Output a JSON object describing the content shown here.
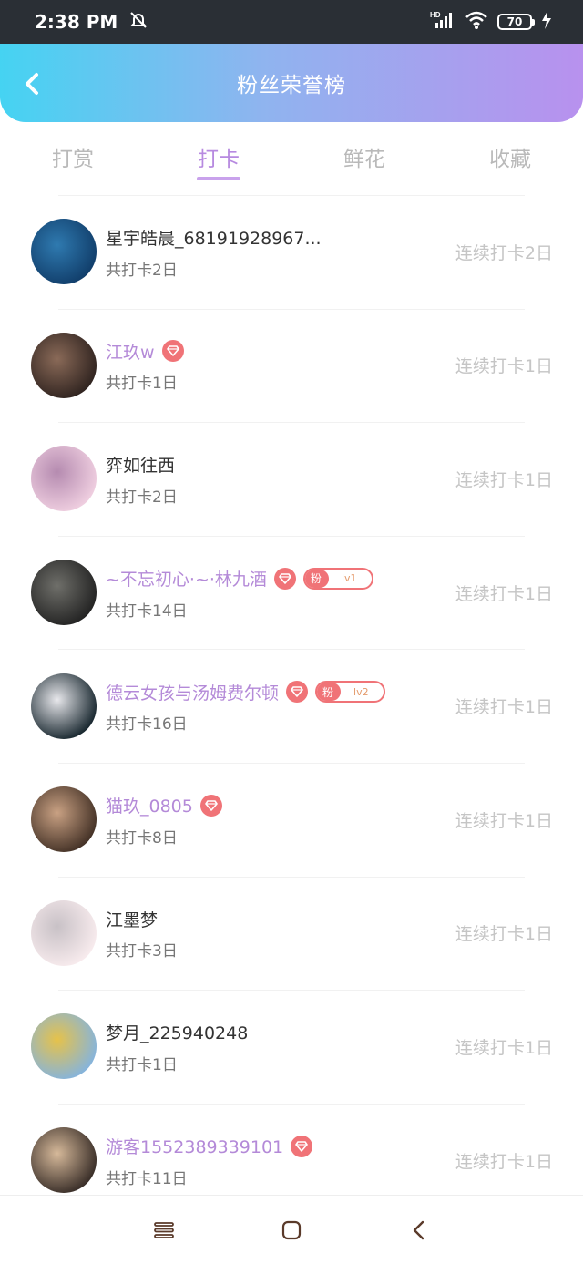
{
  "status_bar": {
    "time": "2:38 PM",
    "battery": "70",
    "network": "HD",
    "icons": [
      "mute-bell-icon",
      "signal-icon",
      "wifi-icon",
      "battery-icon",
      "charging-icon"
    ]
  },
  "header": {
    "title": "粉丝荣誉榜",
    "back_icon": "chevron-left-icon"
  },
  "tabs": [
    {
      "label": "打赏",
      "active": false
    },
    {
      "label": "打卡",
      "active": true
    },
    {
      "label": "鲜花",
      "active": false
    },
    {
      "label": "收藏",
      "active": false
    }
  ],
  "rows": [
    {
      "name": "星宇皓晨_68191928967...",
      "vip": false,
      "total": "共打卡2日",
      "streak": "连续打卡2日",
      "avatar": [
        "#0f3a66",
        "#2f7ab0"
      ]
    },
    {
      "name": "江玖w",
      "vip": true,
      "total": "共打卡1日",
      "streak": "连续打卡1日",
      "avatar": [
        "#2a1f1c",
        "#8a6a58"
      ]
    },
    {
      "name": "弈如往西",
      "vip": false,
      "total": "共打卡2日",
      "streak": "连续打卡1日",
      "avatar": [
        "#f3d3e3",
        "#b58bb0"
      ]
    },
    {
      "name": "~不忘初心·~·林九酒",
      "vip": true,
      "fan_label": "粉",
      "fan_level": "lv1",
      "total": "共打卡14日",
      "streak": "连续打卡1日",
      "avatar": [
        "#1e1e1e",
        "#6f6f6a"
      ]
    },
    {
      "name": "德云女孩与汤姆费尔顿",
      "vip": true,
      "fan_label": "粉",
      "fan_level": "lv2",
      "total": "共打卡16日",
      "streak": "连续打卡1日",
      "avatar": [
        "#0a1a22",
        "#e8e8ec"
      ]
    },
    {
      "name": "猫玖_0805",
      "vip": true,
      "total": "共打卡8日",
      "streak": "连续打卡1日",
      "avatar": [
        "#3b2a20",
        "#c9a183"
      ]
    },
    {
      "name": "江墨梦",
      "vip": false,
      "total": "共打卡3日",
      "streak": "连续打卡1日",
      "avatar": [
        "#fbeef0",
        "#c8c1c6"
      ]
    },
    {
      "name": "梦月_225940248",
      "vip": false,
      "total": "共打卡1日",
      "streak": "连续打卡1日",
      "avatar": [
        "#7fb3e6",
        "#e6c24a"
      ]
    },
    {
      "name": "游客1552389339101",
      "vip": true,
      "total": "共打卡11日",
      "streak": "连续打卡1日",
      "avatar": [
        "#2e2420",
        "#d6b99a"
      ]
    }
  ],
  "colors": {
    "accent": "#b78ae0",
    "vip_name": "#b48ad8",
    "badge": "#f07377"
  },
  "nav_bar": [
    "menu-icon",
    "home-square-icon",
    "back-triangle-icon"
  ]
}
